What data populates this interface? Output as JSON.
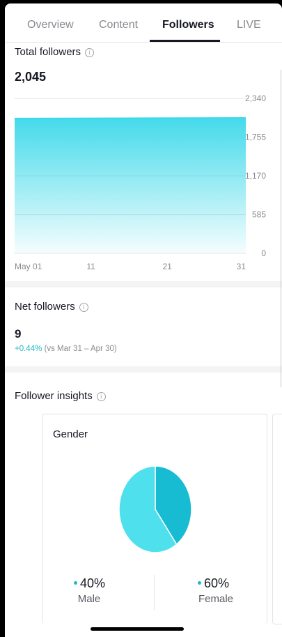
{
  "tabs": [
    "Overview",
    "Content",
    "Followers",
    "LIVE"
  ],
  "active_tab": "Followers",
  "total_followers": {
    "title": "Total followers",
    "value": "2,045",
    "info_icon": "info-icon"
  },
  "chart_data": {
    "type": "area",
    "x_tick_labels": [
      "May 01",
      "11",
      "21",
      "31"
    ],
    "y_tick_labels": [
      "2,340",
      "1,755",
      "1,170",
      "585",
      "0"
    ],
    "x_range": [
      1,
      31
    ],
    "ylim": [
      0,
      2340
    ],
    "x": [
      1,
      31
    ],
    "values": [
      2036,
      2045
    ],
    "color": "#3ad8ea",
    "grid": true
  },
  "net_followers": {
    "title": "Net followers",
    "value": "9",
    "change": "+0.44%",
    "context": "(vs Mar 31 – Apr 30)"
  },
  "follower_insights": {
    "title": "Follower insights",
    "gender_card": {
      "title": "Gender",
      "slices": [
        {
          "label": "Male",
          "percent": 40,
          "percent_text": "40%",
          "color": "#17bcd3"
        },
        {
          "label": "Female",
          "percent": 60,
          "percent_text": "60%",
          "color": "#4fe0ee"
        }
      ]
    }
  },
  "colors": {
    "accent": "#20b8c8",
    "area_top": "#3ad8ea"
  }
}
